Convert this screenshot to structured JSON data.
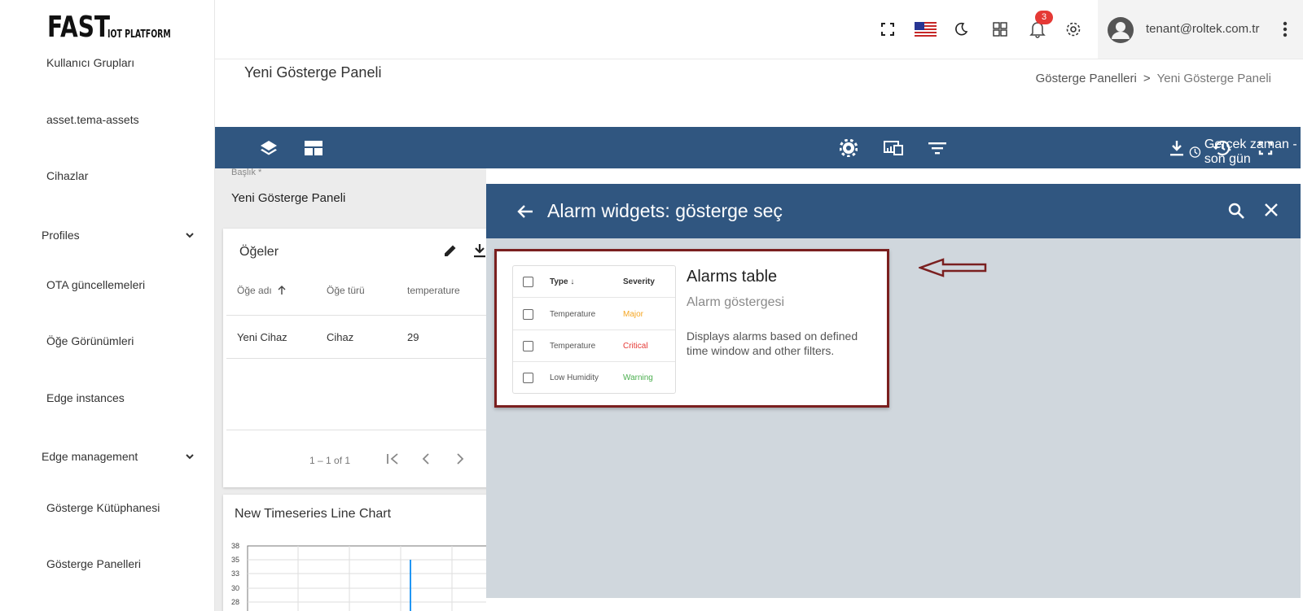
{
  "logo": {
    "big": "FAST",
    "small": "IOT PLATFORM"
  },
  "sidebar": {
    "items": [
      {
        "label": "Kullanıcı Grupları"
      },
      {
        "label": "asset.tema-assets"
      },
      {
        "label": "Cihazlar"
      },
      {
        "label": "Profiles"
      },
      {
        "label": "OTA güncellemeleri"
      },
      {
        "label": "Öğe Görünümleri"
      },
      {
        "label": "Edge instances"
      },
      {
        "label": "Edge management"
      },
      {
        "label": "Gösterge Kütüphanesi"
      },
      {
        "label": "Gösterge Panelleri"
      }
    ]
  },
  "topbar": {
    "notification_count": "3",
    "user_email": "tenant@roltek.com.tr",
    "icons": [
      "fullscreen-icon",
      "us-flag-icon",
      "moon-icon",
      "apps-grid-icon",
      "bell-icon",
      "gear-icon",
      "account-icon",
      "more-vert-icon"
    ]
  },
  "page": {
    "title": "Yeni Gösterge Paneli",
    "breadcrumb": {
      "parent": "Gösterge Panelleri",
      "separator": ">",
      "current": "Yeni Gösterge Paneli"
    }
  },
  "toolbar": {
    "time_window": "Gerçek zaman - son gün",
    "icons": [
      "layers-icon",
      "layout-icon",
      "settings-icon",
      "devices-icon",
      "filter-icon",
      "clock-icon",
      "download-icon",
      "history-icon",
      "fullscreen-icon"
    ]
  },
  "dashboard": {
    "field_label": "Başlık *",
    "field_value": "Yeni Gösterge Paneli",
    "entities_card": {
      "title": "Öğeler",
      "columns": [
        "Öğe adı",
        "Öğe türü",
        "temperature"
      ],
      "rows": [
        [
          "Yeni Cihaz",
          "Cihaz",
          "29"
        ]
      ],
      "paginator": "1 – 1 of 1"
    },
    "chart_card": {
      "title": "New Timeseries Line Chart",
      "y_ticks": [
        "38",
        "35",
        "33",
        "30",
        "28"
      ]
    }
  },
  "selector": {
    "title": "Alarm widgets: gösterge seç",
    "widget": {
      "title": "Alarms table",
      "subtitle": "Alarm göstergesi",
      "description": "Displays alarms based on defined time window and other filters.",
      "preview": {
        "header": {
          "type": "Type",
          "severity": "Severity"
        },
        "rows": [
          {
            "type": "Temperature",
            "severity": "Major",
            "color": "#f5a623"
          },
          {
            "type": "Temperature",
            "severity": "Critical",
            "color": "#e53935"
          },
          {
            "type": "Low Humidity",
            "severity": "Warning",
            "color": "#4caf50"
          }
        ]
      }
    }
  },
  "colors": {
    "primary": "#305680",
    "highlight_border": "#7a1f1f",
    "badge": "#e53935",
    "panel_bg": "#d0d7dd"
  }
}
